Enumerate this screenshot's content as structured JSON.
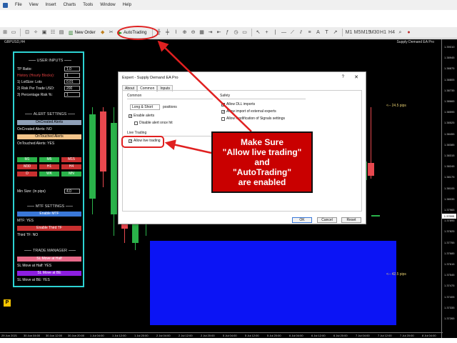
{
  "menu": {
    "items": [
      "File",
      "View",
      "Insert",
      "Charts",
      "Tools",
      "Window",
      "Help"
    ]
  },
  "toolbar": {
    "new_order_label": "New Order",
    "autotrading_label": "AutoTrading"
  },
  "chart": {
    "symbol_label": "GBPUSD,H4",
    "indicator_label": "Supply Demand EA Pro",
    "prices": [
      "1.39010",
      "1.38945",
      "1.38875",
      "1.38805",
      "1.38735",
      "1.38665",
      "1.38595",
      "1.38525",
      "1.38455",
      "1.38385",
      "1.38315",
      "1.38245",
      "1.38175",
      "1.38105",
      "1.38035",
      "1.37965",
      "1.37895",
      "1.37825",
      "1.37755",
      "1.37685",
      "1.37615",
      "1.37545",
      "1.37475",
      "1.37405",
      "1.37335",
      "1.37265"
    ],
    "current_price": "1.37895",
    "times": [
      "29 Jun 2021",
      "30 Jun 04:00",
      "30 Jun 12:00",
      "30 Jun 20:00",
      "1 Jul 04:00",
      "1 Jul 12:00",
      "1 Jul 20:00",
      "2 Jul 04:00",
      "2 Jul 12:00",
      "2 Jul 20:00",
      "5 Jul 04:00",
      "5 Jul 12:00",
      "5 Jul 20:00",
      "6 Jul 04:00",
      "6 Jul 12:00",
      "6 Jul 20:00",
      "7 Jul 04:00",
      "7 Jul 12:00",
      "7 Jul 20:00",
      "8 Jul 04:00"
    ],
    "supply_pips": "<-- 24.5 pips",
    "demand_pips": "<-- 42.5 pips",
    "p_badge": "P"
  },
  "panel": {
    "user_inputs_title": "USER INPUTS",
    "tp_ratio_label": "TP Ratio:",
    "tp_ratio_value": "1.0",
    "history_label": "History (Hourly Blocks):",
    "history_value": "1",
    "lotsize_label": "1) LotSize: Lots",
    "lotsize_value": "0.01",
    "risk_label": "2) Risk Per Trade USD:",
    "risk_value": "200",
    "pct_label": "3) Percentage Risk %:",
    "pct_value": "1",
    "alert_title": "ALERT SETTINGS",
    "oncreated_btn": "OnCreated Alerts",
    "oncreated_status": "OnCreated Alerts: NO",
    "ontouched_btn": "OnTouched Alerts",
    "ontouched_status": "OnTouched Alerts: YES",
    "tf_buttons": [
      "M1",
      "M5",
      "M15",
      "M30",
      "H1",
      "H4",
      "D",
      "WK",
      "MN"
    ],
    "min_size_label": "Min Size: (in pips)",
    "min_size_value": "4.0",
    "mtf_title": "MTF SETTINGS",
    "enable_mtf_btn": "Enable MTF",
    "mtf_status": "MTF: YES",
    "enable_third_btn": "Enable Third TF",
    "third_status": "Third TF: NO",
    "trade_title": "TRADE MANAGER",
    "sl_half_btn": "SL Move at Half",
    "sl_half_status": "SL Move at Half: YES",
    "sl_be_btn": "SL Move at BE",
    "sl_be_status": "SL Move at BE: YES"
  },
  "dialog": {
    "title": "Expert - Supply Demand EA Pro",
    "help_glyph": "?",
    "close_glyph": "✕",
    "tabs": [
      "About",
      "Common",
      "Inputs"
    ],
    "common_group": "Common",
    "positions_select": "Long & Short",
    "positions_label": "positions",
    "enable_alerts": "Enable alerts",
    "disable_alert_once": "Disable alert once hit",
    "live_group": "Live Trading",
    "allow_live": "Allow live trading",
    "safety_group": "Safety",
    "allow_dll": "Allow DLL imports",
    "allow_import": "Allow import of external experts",
    "allow_modify": "Allow modification of Signals settings",
    "ok_label": "OK",
    "cancel_label": "Cancel",
    "reset_label": "Reset"
  },
  "callout": {
    "line1": "Make Sure",
    "line2": "\"Allow live trading\"",
    "line3": "and",
    "line4": "\"AutoTrading\"",
    "line5": "are enabled"
  },
  "colors": {
    "accent_red": "#e02020",
    "callout_red": "#c90000",
    "panel_border": "#2dd3d3",
    "bull": "#2ab24a",
    "bear": "#e8484f",
    "demand_zone": "#0b14f5"
  }
}
